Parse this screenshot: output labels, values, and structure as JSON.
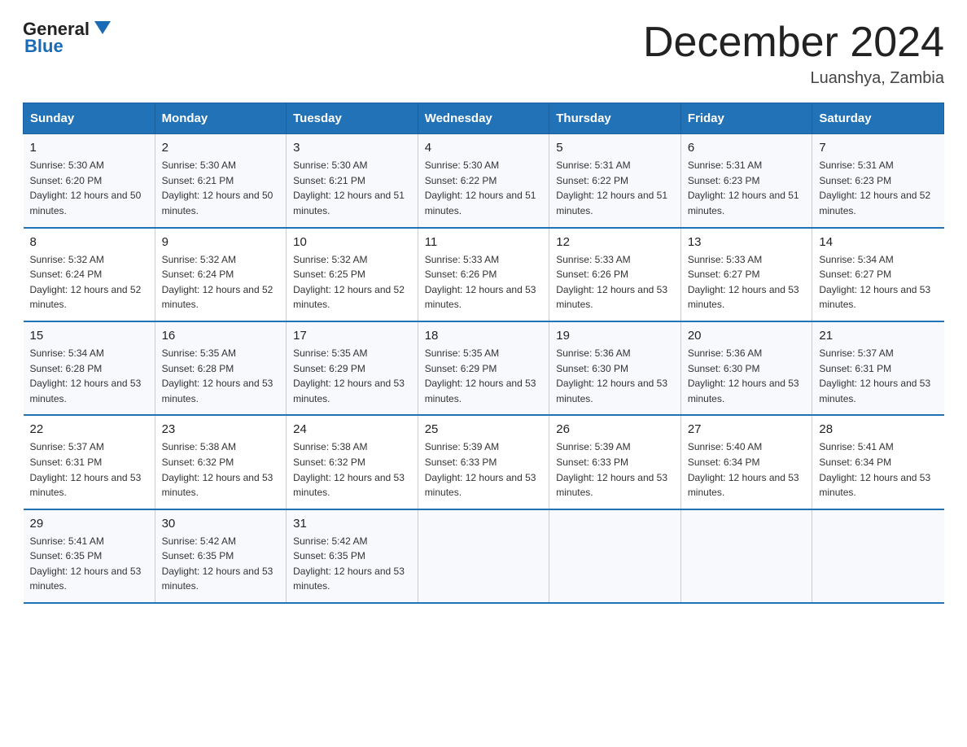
{
  "logo": {
    "line1": "General",
    "line2": "Blue"
  },
  "header": {
    "title": "December 2024",
    "subtitle": "Luanshya, Zambia"
  },
  "weekdays": [
    "Sunday",
    "Monday",
    "Tuesday",
    "Wednesday",
    "Thursday",
    "Friday",
    "Saturday"
  ],
  "weeks": [
    [
      {
        "day": "1",
        "sunrise": "5:30 AM",
        "sunset": "6:20 PM",
        "daylight": "12 hours and 50 minutes."
      },
      {
        "day": "2",
        "sunrise": "5:30 AM",
        "sunset": "6:21 PM",
        "daylight": "12 hours and 50 minutes."
      },
      {
        "day": "3",
        "sunrise": "5:30 AM",
        "sunset": "6:21 PM",
        "daylight": "12 hours and 51 minutes."
      },
      {
        "day": "4",
        "sunrise": "5:30 AM",
        "sunset": "6:22 PM",
        "daylight": "12 hours and 51 minutes."
      },
      {
        "day": "5",
        "sunrise": "5:31 AM",
        "sunset": "6:22 PM",
        "daylight": "12 hours and 51 minutes."
      },
      {
        "day": "6",
        "sunrise": "5:31 AM",
        "sunset": "6:23 PM",
        "daylight": "12 hours and 51 minutes."
      },
      {
        "day": "7",
        "sunrise": "5:31 AM",
        "sunset": "6:23 PM",
        "daylight": "12 hours and 52 minutes."
      }
    ],
    [
      {
        "day": "8",
        "sunrise": "5:32 AM",
        "sunset": "6:24 PM",
        "daylight": "12 hours and 52 minutes."
      },
      {
        "day": "9",
        "sunrise": "5:32 AM",
        "sunset": "6:24 PM",
        "daylight": "12 hours and 52 minutes."
      },
      {
        "day": "10",
        "sunrise": "5:32 AM",
        "sunset": "6:25 PM",
        "daylight": "12 hours and 52 minutes."
      },
      {
        "day": "11",
        "sunrise": "5:33 AM",
        "sunset": "6:26 PM",
        "daylight": "12 hours and 53 minutes."
      },
      {
        "day": "12",
        "sunrise": "5:33 AM",
        "sunset": "6:26 PM",
        "daylight": "12 hours and 53 minutes."
      },
      {
        "day": "13",
        "sunrise": "5:33 AM",
        "sunset": "6:27 PM",
        "daylight": "12 hours and 53 minutes."
      },
      {
        "day": "14",
        "sunrise": "5:34 AM",
        "sunset": "6:27 PM",
        "daylight": "12 hours and 53 minutes."
      }
    ],
    [
      {
        "day": "15",
        "sunrise": "5:34 AM",
        "sunset": "6:28 PM",
        "daylight": "12 hours and 53 minutes."
      },
      {
        "day": "16",
        "sunrise": "5:35 AM",
        "sunset": "6:28 PM",
        "daylight": "12 hours and 53 minutes."
      },
      {
        "day": "17",
        "sunrise": "5:35 AM",
        "sunset": "6:29 PM",
        "daylight": "12 hours and 53 minutes."
      },
      {
        "day": "18",
        "sunrise": "5:35 AM",
        "sunset": "6:29 PM",
        "daylight": "12 hours and 53 minutes."
      },
      {
        "day": "19",
        "sunrise": "5:36 AM",
        "sunset": "6:30 PM",
        "daylight": "12 hours and 53 minutes."
      },
      {
        "day": "20",
        "sunrise": "5:36 AM",
        "sunset": "6:30 PM",
        "daylight": "12 hours and 53 minutes."
      },
      {
        "day": "21",
        "sunrise": "5:37 AM",
        "sunset": "6:31 PM",
        "daylight": "12 hours and 53 minutes."
      }
    ],
    [
      {
        "day": "22",
        "sunrise": "5:37 AM",
        "sunset": "6:31 PM",
        "daylight": "12 hours and 53 minutes."
      },
      {
        "day": "23",
        "sunrise": "5:38 AM",
        "sunset": "6:32 PM",
        "daylight": "12 hours and 53 minutes."
      },
      {
        "day": "24",
        "sunrise": "5:38 AM",
        "sunset": "6:32 PM",
        "daylight": "12 hours and 53 minutes."
      },
      {
        "day": "25",
        "sunrise": "5:39 AM",
        "sunset": "6:33 PM",
        "daylight": "12 hours and 53 minutes."
      },
      {
        "day": "26",
        "sunrise": "5:39 AM",
        "sunset": "6:33 PM",
        "daylight": "12 hours and 53 minutes."
      },
      {
        "day": "27",
        "sunrise": "5:40 AM",
        "sunset": "6:34 PM",
        "daylight": "12 hours and 53 minutes."
      },
      {
        "day": "28",
        "sunrise": "5:41 AM",
        "sunset": "6:34 PM",
        "daylight": "12 hours and 53 minutes."
      }
    ],
    [
      {
        "day": "29",
        "sunrise": "5:41 AM",
        "sunset": "6:35 PM",
        "daylight": "12 hours and 53 minutes."
      },
      {
        "day": "30",
        "sunrise": "5:42 AM",
        "sunset": "6:35 PM",
        "daylight": "12 hours and 53 minutes."
      },
      {
        "day": "31",
        "sunrise": "5:42 AM",
        "sunset": "6:35 PM",
        "daylight": "12 hours and 53 minutes."
      },
      null,
      null,
      null,
      null
    ]
  ]
}
